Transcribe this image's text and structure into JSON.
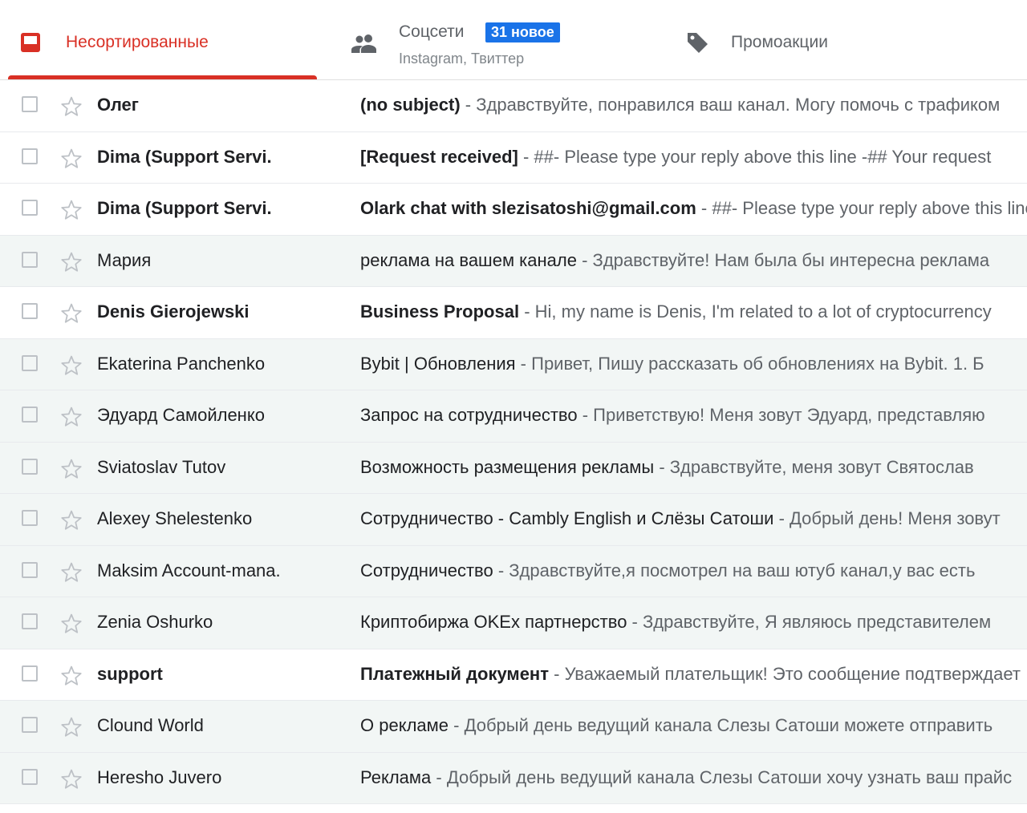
{
  "tabs": [
    {
      "label": "Несортированные",
      "icon": "inbox-icon",
      "active": true,
      "color": "#d93025"
    },
    {
      "label": "Соцсети",
      "icon": "people-icon",
      "badge": "31 новое",
      "sub": "Instagram, Твиттер",
      "badge_color": "#1a73e8"
    },
    {
      "label": "Промоакции",
      "icon": "tag-icon"
    }
  ],
  "separator": " - ",
  "emails": [
    {
      "sender": "Олег",
      "subject": "(no subject)",
      "preview": "Здравствуйте, понравился ваш канал. Могу помочь с трафиком",
      "unread": true
    },
    {
      "sender": "Dima (Support Servi.",
      "subject": "[Request received]",
      "preview": "##- Please type your reply above this line -## Your request",
      "unread": true
    },
    {
      "sender": "Dima (Support Servi.",
      "subject": "Olark chat with slezisatoshi@gmail.com",
      "preview": "##- Please type your reply above this line",
      "unread": true
    },
    {
      "sender": "Мария",
      "subject": "реклама на вашем канале",
      "preview": "Здравствуйте! Нам была бы интересна реклама",
      "unread": false
    },
    {
      "sender": "Denis Gierojewski",
      "subject": "Business Proposal",
      "preview": "Hi, my name is Denis, I'm related to a lot of cryptocurrency",
      "unread": true
    },
    {
      "sender": "Ekaterina Panchenko",
      "subject": "Bybit | Обновления",
      "preview": "Привет, Пишу рассказать об обновлениях на Bybit. 1. Б",
      "unread": false
    },
    {
      "sender": "Эдуард Самойленко",
      "subject": "Запрос на сотрудничество",
      "preview": "Приветствую! Меня зовут Эдуард, представляю",
      "unread": false
    },
    {
      "sender": "Sviatoslav Tutov",
      "subject": "Возможность размещения рекламы",
      "preview": "Здравствуйте, меня зовут Святослав",
      "unread": false
    },
    {
      "sender": "Alexey Shelestenko",
      "subject": "Сотрудничество - Cambly English и Слёзы Сатоши",
      "preview": "Добрый день! Меня зовут",
      "unread": false
    },
    {
      "sender": "Maksim Account-mana.",
      "subject": "Сотрудничество",
      "preview": "Здравствуйте,я посмотрел на ваш ютуб канал,у вас есть",
      "unread": false
    },
    {
      "sender": "Zenia Oshurko",
      "subject": "Криптобиржа OKEx партнерство",
      "preview": "Здравствуйте, Я являюсь представителем",
      "unread": false
    },
    {
      "sender": "support",
      "subject": "Платежный документ",
      "preview": "Уважаемый плательщик! Это сообщение подтверждает",
      "unread": true
    },
    {
      "sender": "Clound World",
      "subject": "О рекламе",
      "preview": "Добрый день ведущий канала Слезы Сатоши можете отправить",
      "unread": false
    },
    {
      "sender": "Heresho Juvero",
      "subject": "Реклама",
      "preview": "Добрый день ведущий канала Слезы Сатоши хочу узнать ваш прайс",
      "unread": false
    }
  ]
}
